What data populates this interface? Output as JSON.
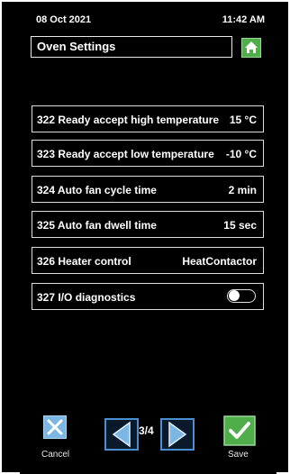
{
  "status_bar": {
    "date": "08 Oct 2021",
    "time": "11:42 AM"
  },
  "header": {
    "title": "Oven Settings",
    "home_icon": "home-icon"
  },
  "settings": [
    {
      "label": "322 Ready accept high temperature",
      "value": "15 °C"
    },
    {
      "label": "323 Ready accept low temperature",
      "value": "-10 °C"
    },
    {
      "label": "324 Auto fan cycle time",
      "value": "2 min"
    },
    {
      "label": "325 Auto fan dwell time",
      "value": "15 sec"
    },
    {
      "label": "326 Heater control",
      "value": "HeatContactor"
    },
    {
      "label": "327 I/O diagnostics",
      "toggle_on": false
    }
  ],
  "footer": {
    "cancel_label": "Cancel",
    "page_indicator": "3/4",
    "save_label": "Save"
  },
  "colors": {
    "background": "#000000",
    "accent_green": "#4fae4a",
    "accent_blue": "#7cb6e3"
  }
}
